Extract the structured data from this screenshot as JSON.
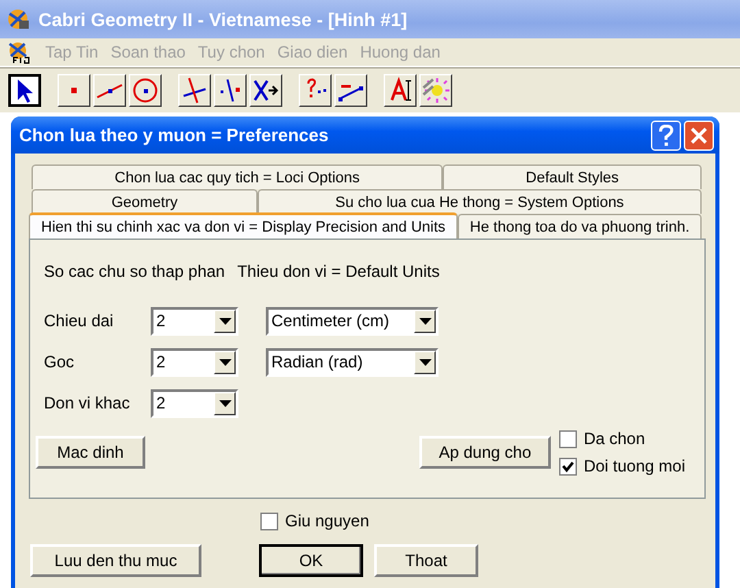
{
  "app": {
    "title": "Cabri Geometry II - Vietnamese - [Hinh #1]",
    "menu": [
      {
        "label": "Tap Tin",
        "disabled": true
      },
      {
        "label": "Soan thao",
        "disabled": true
      },
      {
        "label": "Tuy chon",
        "disabled": true
      },
      {
        "label": "Giao dien",
        "disabled": true
      },
      {
        "label": "Huong dan",
        "disabled": true
      }
    ],
    "toolbar": [
      [
        {
          "kind": "pointer",
          "selected": true
        }
      ],
      [
        {
          "kind": "point",
          "selected": false
        },
        {
          "kind": "segment",
          "selected": false
        },
        {
          "kind": "circle",
          "selected": false
        }
      ],
      [
        {
          "kind": "perpendicular",
          "selected": false
        },
        {
          "kind": "reflect",
          "selected": false
        },
        {
          "kind": "transform",
          "selected": false
        }
      ],
      [
        {
          "kind": "check",
          "selected": false
        },
        {
          "kind": "measure",
          "selected": false
        }
      ],
      [
        {
          "kind": "label",
          "selected": false
        },
        {
          "kind": "display",
          "selected": false
        }
      ]
    ]
  },
  "dialog": {
    "title": "Chon lua theo y muon = Preferences",
    "tab_rows": [
      [
        {
          "label": "Chon lua cac quy tich = Loci Options",
          "selected": false
        },
        {
          "label": "Default Styles",
          "selected": false
        }
      ],
      [
        {
          "label": "Geometry",
          "selected": false
        },
        {
          "label": "Su cho lua cua He thong = System Options",
          "selected": false
        }
      ],
      [
        {
          "label": "Hien thi su chinh xac va don vi = Display Precision and Units",
          "selected": true
        },
        {
          "label": "He thong toa do va phuong trinh.",
          "selected": false
        }
      ]
    ],
    "precision_heading": "So cac chu so thap phan",
    "units_heading": "Thieu don vi = Default Units",
    "rows": [
      {
        "label": "Chieu dai",
        "digits": "2",
        "unit": "Centimeter (cm)"
      },
      {
        "label": "Goc",
        "digits": "2",
        "unit": "Radian (rad)"
      },
      {
        "label": "Don vi khac",
        "digits": "2"
      }
    ],
    "default_button": "Mac dinh",
    "apply_button": "Ap dung cho",
    "apply_options": [
      {
        "label": "Da chon",
        "checked": false
      },
      {
        "label": "Doi tuong moi",
        "checked": true
      }
    ],
    "keep": {
      "label": "Giu nguyen",
      "checked": false
    },
    "buttons": [
      {
        "label": "Luu den thu muc",
        "default": false
      },
      {
        "label": "OK",
        "default": true
      },
      {
        "label": "Thoat",
        "default": false
      }
    ]
  }
}
